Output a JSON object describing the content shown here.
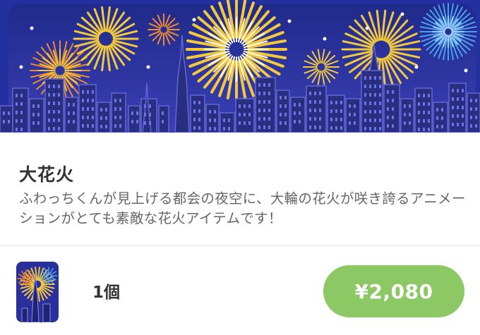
{
  "item": {
    "title": "大花火",
    "description": "ふわっちくんが見上げる都会の夜空に、大輪の花火が咲き誇るアニメーションがとても素敵な花火アイテムです！"
  },
  "purchase": {
    "quantity": "1個",
    "price": "¥2,080"
  },
  "banner": {
    "icon": "fireworks-city-night-illustration",
    "sky_color": "#2b2f9c",
    "building_color": "#2a2e80",
    "firework_colors": [
      "#f3c83a",
      "#f08a2e",
      "#4aa3f0"
    ]
  },
  "thumbnail": {
    "icon": "fireworks-tower-thumbnail"
  },
  "colors": {
    "price_button": "#8cc864",
    "title_text": "#333333",
    "description_text": "#666666"
  }
}
